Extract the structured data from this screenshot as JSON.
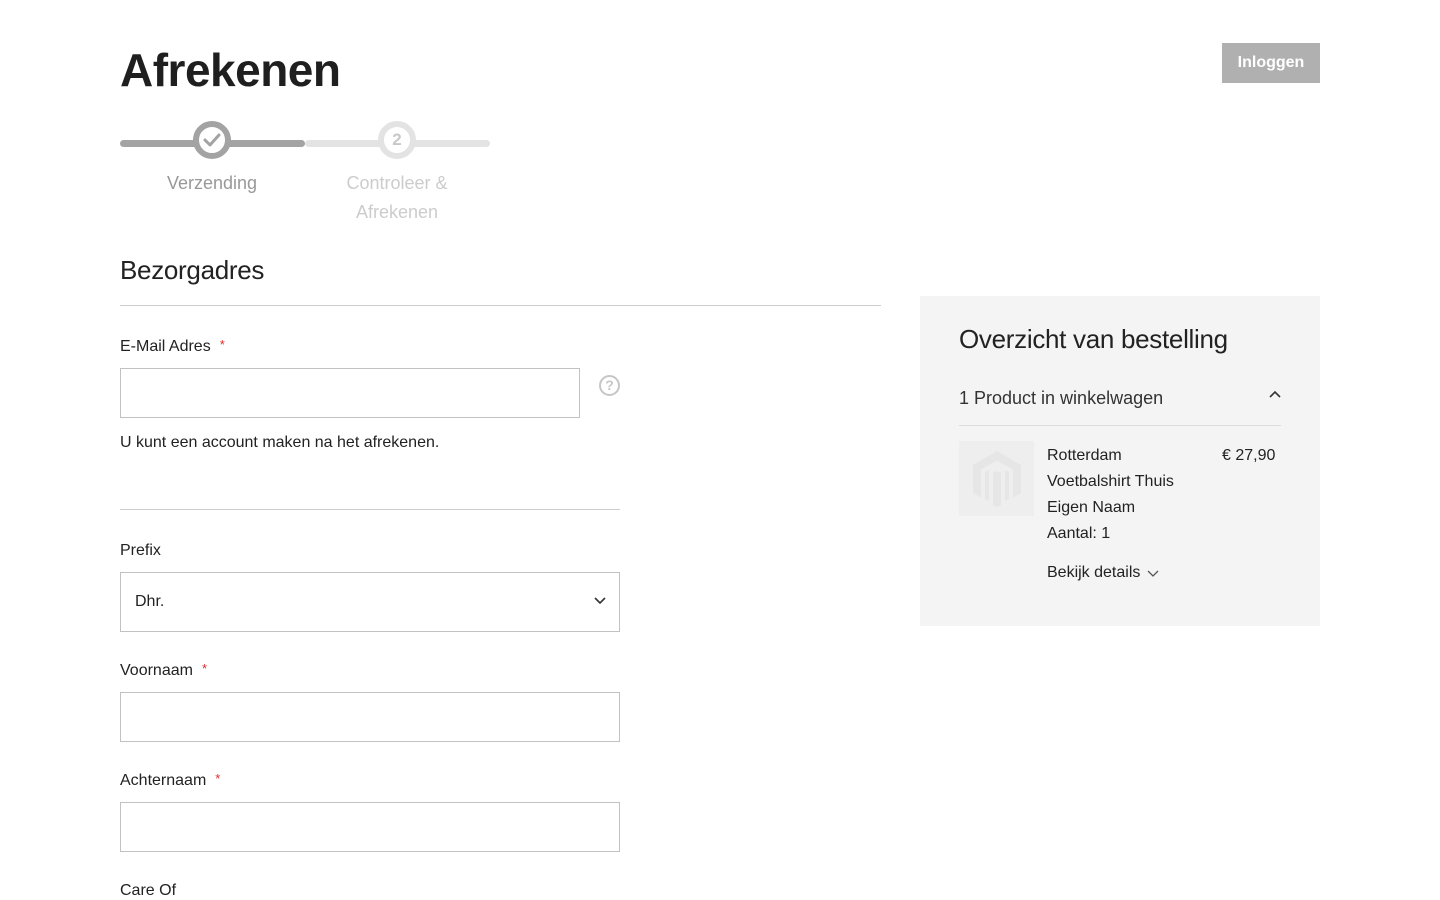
{
  "header": {
    "title": "Afrekenen",
    "login_label": "Inloggen"
  },
  "progress": {
    "steps": [
      {
        "number": "1",
        "label": "Verzending",
        "state": "complete"
      },
      {
        "number": "2",
        "label": "Controleer & Afrekenen",
        "state": "upcoming"
      }
    ]
  },
  "shipping": {
    "title": "Bezorgadres",
    "email": {
      "label": "E-Mail Adres",
      "required_mark": "*",
      "value": "",
      "note": "U kunt een account maken na het afrekenen."
    },
    "prefix": {
      "label": "Prefix",
      "selected": "Dhr."
    },
    "firstname": {
      "label": "Voornaam",
      "required_mark": "*",
      "value": ""
    },
    "lastname": {
      "label": "Achternaam",
      "required_mark": "*",
      "value": ""
    },
    "care_of": {
      "label": "Care Of"
    }
  },
  "summary": {
    "title": "Overzicht van bestelling",
    "count_label": "1 Product in winkelwagen",
    "product": {
      "name": "Rotterdam Voetbalshirt Thuis Eigen Naam",
      "price": "€ 27,90",
      "quantity": "Aantal: 1",
      "details_label": "Bekijk details"
    }
  },
  "colors": {
    "progress_done": "#a3a3a3",
    "progress_todo": "#e3e3e3",
    "required": "#e02b27",
    "login_button": "#b0b0b0",
    "summary_background": "#f4f4f4"
  },
  "icons": {
    "step_complete": "check-icon",
    "help": "question-mark-icon",
    "select": "chevron-down-icon",
    "collapse": "chevron-up-icon",
    "product_placeholder": "magento-logo-icon"
  }
}
